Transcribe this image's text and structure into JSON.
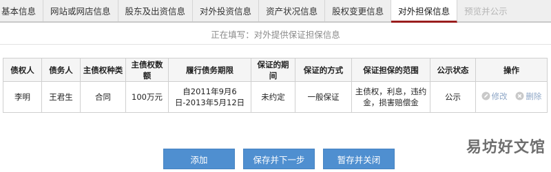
{
  "tabs": [
    {
      "label": "基本信息"
    },
    {
      "label": "网站或网店信息"
    },
    {
      "label": "股东及出资信息"
    },
    {
      "label": "对外投资信息"
    },
    {
      "label": "资产状况信息"
    },
    {
      "label": "股权变更信息"
    },
    {
      "label": "对外担保信息",
      "active": true
    },
    {
      "label": "预览并公示",
      "disabled": true
    }
  ],
  "subtitle": "正在填写：对外提供保证担保信息",
  "table": {
    "headers": [
      "债权人",
      "债务人",
      "主债权种类",
      "主债权数额",
      "履行债务期限",
      "保证的期间",
      "保证的方式",
      "保证担保的范围",
      "公示状态",
      "操作"
    ],
    "rows": [
      {
        "creditor": "李明",
        "debtor": "王君生",
        "claim_type": "合同",
        "claim_amount": "100万元",
        "period": "自2011年9月6日-2013年5月12日",
        "guarantee_period": "未约定",
        "guarantee_method": "一般保证",
        "scope": "主债权，利息，违约金，损害赔偿金",
        "status": "公示",
        "edit_label": "修改",
        "delete_label": "删除"
      }
    ]
  },
  "buttons": {
    "add": "添加",
    "save_next": "保存并下一步",
    "save_close": "暂存并关闭"
  },
  "watermark": "易坊好文馆",
  "colors": {
    "active_tab_underline": "#9a1d1d",
    "button_bg": "#4f8fd0",
    "link": "#8fa7c7"
  }
}
